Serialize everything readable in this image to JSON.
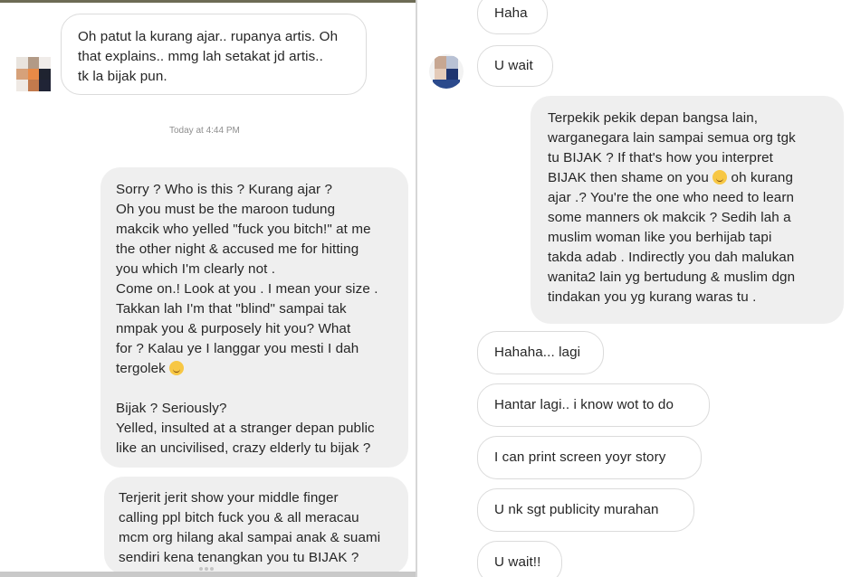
{
  "left_panel": {
    "top_message": {
      "lines": [
        "Oh patut la kurang ajar.. rupanya artis. Oh",
        "that explains.. mmg lah setakat jd artis..",
        "tk la bijak pun."
      ]
    },
    "timestamp": "Today at 4:44 PM",
    "reply_1": {
      "lines": [
        "Sorry ? Who is this ? Kurang ajar ?",
        "Oh you must be the maroon tudung",
        "makcik who yelled \"fuck you bitch!\" at me",
        "the other night & accused me for hitting",
        "you which I'm clearly not .",
        "Come on.! Look at you . I mean your size .",
        "Takkan lah I'm that \"blind\" sampai tak",
        "nmpak you & purposely hit you? What",
        "for ? Kalau ye I langgar you mesti I dah",
        "tergolek",
        "",
        "Bijak ? Seriously?",
        "Yelled, insulted at a stranger depan public",
        "like an uncivilised, crazy elderly tu bijak ?"
      ]
    },
    "reply_2": {
      "lines": [
        "Terjerit jerit show your middle finger",
        "calling ppl bitch fuck you & all meracau",
        "mcm org hilang akal sampai anak & suami",
        "sendiri kena tenangkan you tu BIJAK ?"
      ]
    }
  },
  "right_panel": {
    "incoming_top": [
      "Haha",
      "U wait"
    ],
    "outgoing": {
      "lines": [
        "Terpekik pekik depan bangsa lain,",
        "warganegara lain sampai semua org tgk",
        "tu BIJAK ? If that's how you interpret",
        "BIJAK then shame on you  oh kurang",
        "ajar .? You're the one who need to learn",
        "some manners ok makcik ? Sedih lah a",
        "muslim woman like you berhijab tapi",
        "takda adab . Indirectly you dah malukan",
        "wanita2 lain yg bertudung & muslim dgn",
        "tindakan you yg kurang waras tu ."
      ]
    },
    "incoming_bottom": [
      "Hahaha... lagi",
      "Hantar lagi.. i know wot to do",
      "I can print screen yoyr story",
      "U nk sgt publicity murahan",
      "U wait!!"
    ]
  },
  "colors": {
    "outgoing_bubble": "#efefef",
    "incoming_border": "#dbdbdb",
    "text": "#262626",
    "timestamp": "#8e8e8e",
    "emoji": "#f7c744"
  },
  "icons": {
    "emoji_1": "grinning-sweat-emoji",
    "emoji_2": "slightly-smiling-emoji"
  }
}
